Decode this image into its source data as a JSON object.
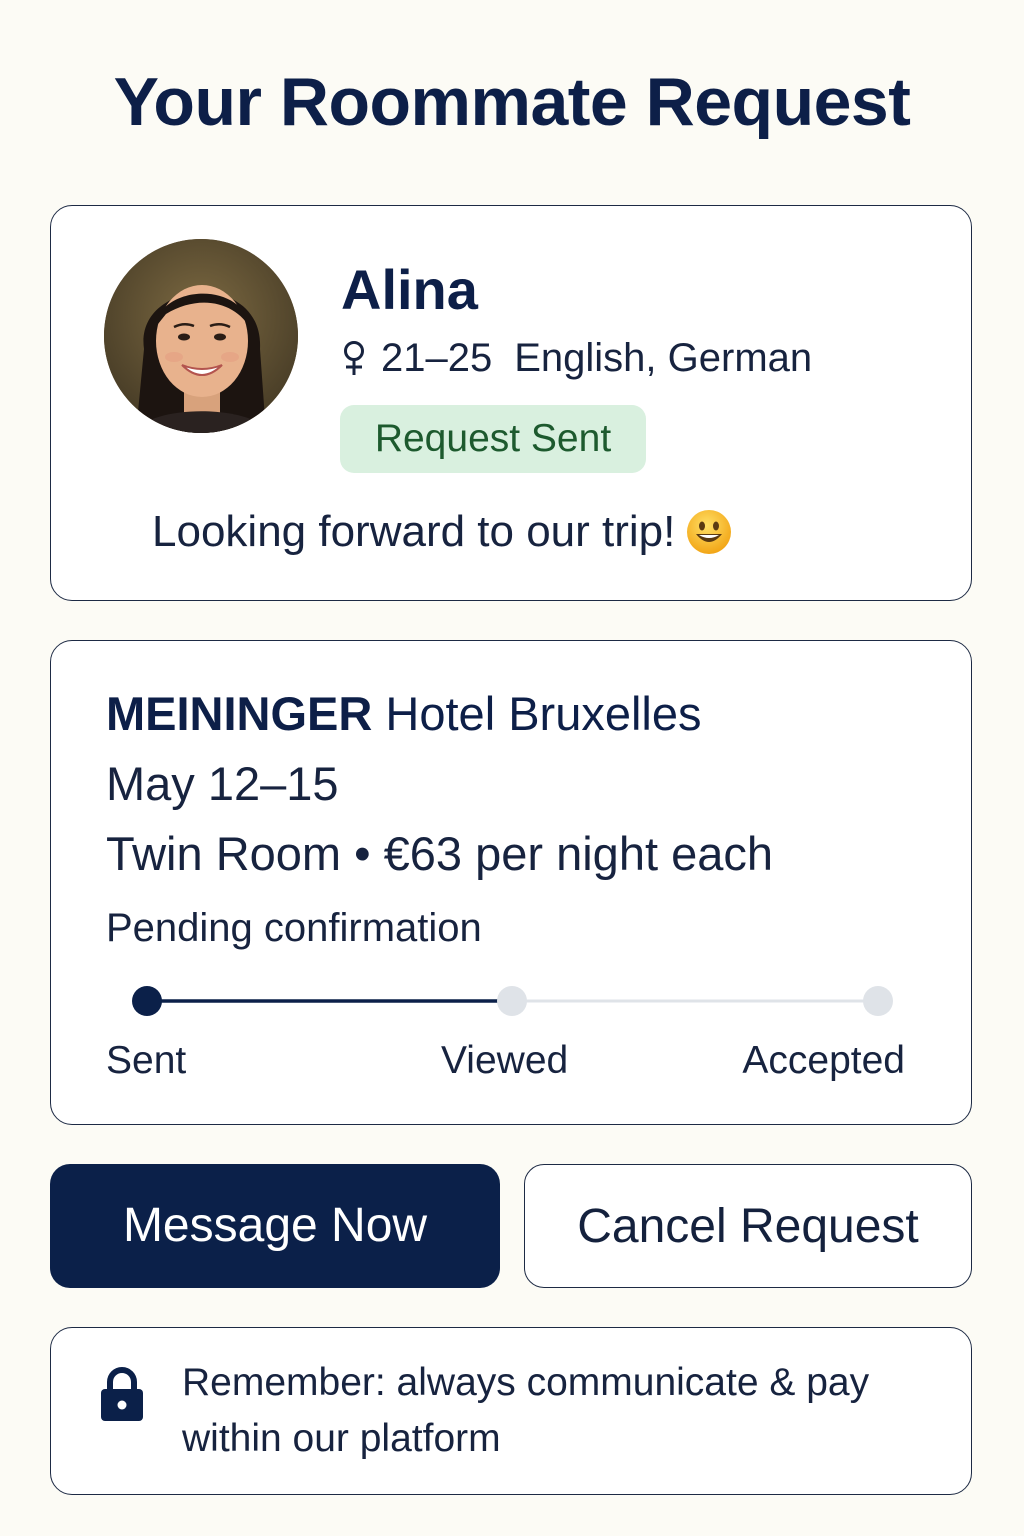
{
  "header": {
    "title": "Your Roommate Request"
  },
  "profile": {
    "name": "Alina",
    "gender_icon": "female-icon",
    "age_range": "21–25",
    "languages": "English, German",
    "status": "Request Sent",
    "message": "Looking forward to our trip!",
    "message_icon": "smiling-face-icon"
  },
  "booking": {
    "hotel_brand": "MEININGER",
    "hotel_name": "Hotel Bruxelles",
    "dates": "May 12–15",
    "room": "Twin Room • €63 per night each",
    "status": "Pending confirmation",
    "steps": [
      {
        "label": "Sent",
        "state": "complete"
      },
      {
        "label": "Viewed",
        "state": "pending"
      },
      {
        "label": "Accepted",
        "state": "pending"
      }
    ]
  },
  "actions": {
    "message_label": "Message Now",
    "cancel_label": "Cancel Request"
  },
  "notice": {
    "icon": "lock-icon",
    "text": "Remember: always communicate & pay within our platform"
  },
  "colors": {
    "primary": "#0b2049",
    "badge_bg": "#d9f0df",
    "badge_text": "#1d5a2e",
    "track_inactive": "#dfe3e8",
    "background": "#fcfbf5"
  }
}
